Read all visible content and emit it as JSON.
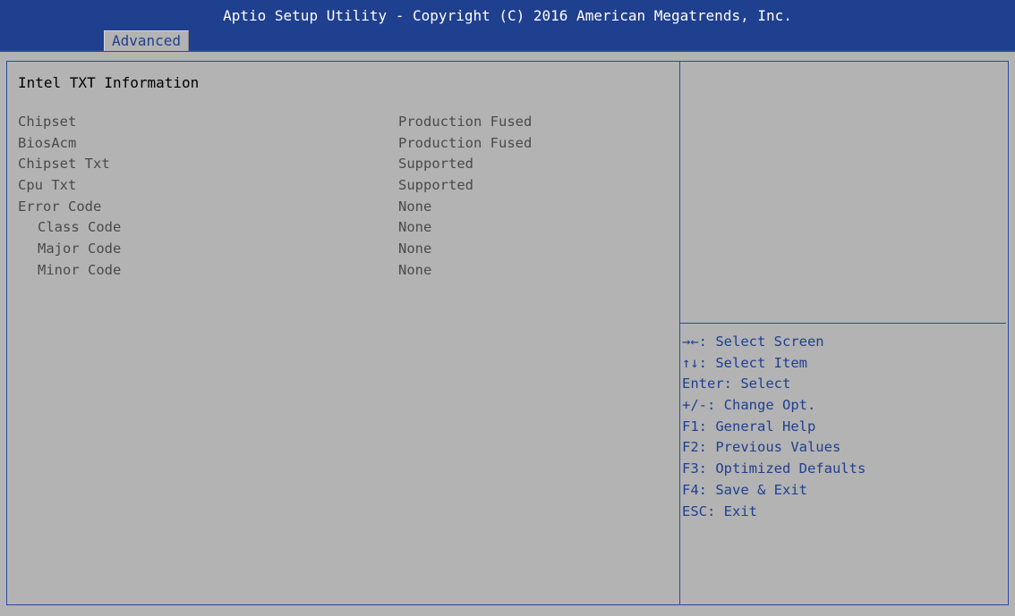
{
  "header": {
    "title": "Aptio Setup Utility - Copyright (C) 2016 American Megatrends, Inc.",
    "active_tab": "Advanced"
  },
  "main": {
    "section_title": "Intel TXT Information",
    "rows": [
      {
        "label": "Chipset",
        "value": "Production Fused"
      },
      {
        "label": "BiosAcm",
        "value": "Production Fused"
      },
      {
        "label": "Chipset Txt",
        "value": "Supported"
      },
      {
        "label": "Cpu Txt",
        "value": "Supported"
      },
      {
        "label": "Error Code",
        "value": "None"
      },
      {
        "label": "Class Code",
        "value": "None"
      },
      {
        "label": "Major Code",
        "value": "None"
      },
      {
        "label": "Minor Code",
        "value": "None"
      }
    ]
  },
  "help": {
    "lines": [
      "→←: Select Screen",
      "↑↓: Select Item",
      "Enter: Select",
      "+/-: Change Opt.",
      "F1: General Help",
      "F2: Previous Values",
      "F3: Optimized Defaults",
      "F4: Save & Exit",
      "ESC: Exit"
    ]
  },
  "colors": {
    "header_bg": "#1f3f8f",
    "body_bg": "#b3b3b3",
    "accent": "#1f3f8f"
  }
}
